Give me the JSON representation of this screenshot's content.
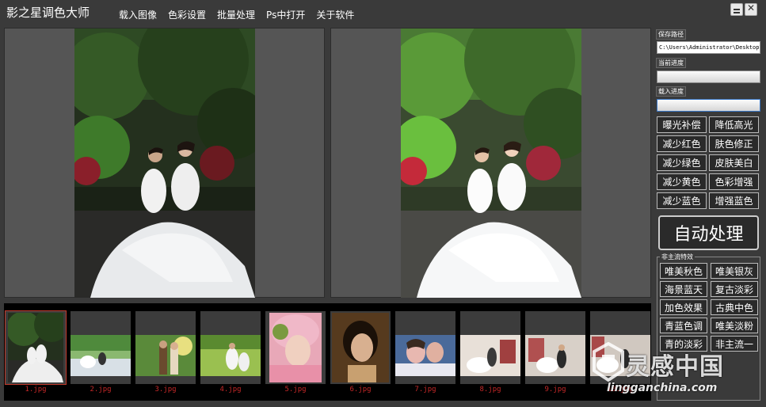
{
  "app": {
    "title": "影之星调色大师"
  },
  "menu": [
    "载入图像",
    "色彩设置",
    "批量处理",
    "Ps中打开",
    "关于软件"
  ],
  "window_controls": {
    "minimize_icon": "minimize-icon",
    "close_icon": "close-icon"
  },
  "sidebar": {
    "save_path_label": "保存路径",
    "save_path_value": "C:\\Users\\Administrator\\Desktop\\",
    "current_progress_label": "当前进度",
    "load_progress_label": "载入进度",
    "current_progress": 0,
    "load_progress": 0,
    "adjust_buttons": [
      "曝光补偿",
      "降低高光",
      "减少红色",
      "肤色修正",
      "减少绿色",
      "皮肤美白",
      "减少黄色",
      "色彩增强",
      "减少蓝色",
      "增强蓝色"
    ],
    "auto_button": "自动处理",
    "style_group_title": "非主流特效",
    "style_buttons": [
      "唯美秋色",
      "唯美银灰",
      "海景蓝天",
      "复古淡彩",
      "加色效果",
      "古典中色",
      "青蓝色调",
      "唯美淡粉",
      "青的淡彩",
      "非主流一"
    ]
  },
  "thumbnails": [
    {
      "label": "1.jpg",
      "selected": true
    },
    {
      "label": "2.jpg",
      "selected": false
    },
    {
      "label": "3.jpg",
      "selected": false
    },
    {
      "label": "4.jpg",
      "selected": false
    },
    {
      "label": "5.jpg",
      "selected": false
    },
    {
      "label": "6.jpg",
      "selected": false
    },
    {
      "label": "7.jpg",
      "selected": false
    },
    {
      "label": "8.jpg",
      "selected": false
    },
    {
      "label": "9.jpg",
      "selected": false
    },
    {
      "label": "10.jpg",
      "selected": false
    }
  ],
  "watermark": {
    "cn": "灵感中国",
    "url": "lingganchina.com"
  },
  "colors": {
    "background": "#3a3a3a",
    "panel": "#555555",
    "strip": "#000000",
    "thumb_label": "#c62828"
  }
}
